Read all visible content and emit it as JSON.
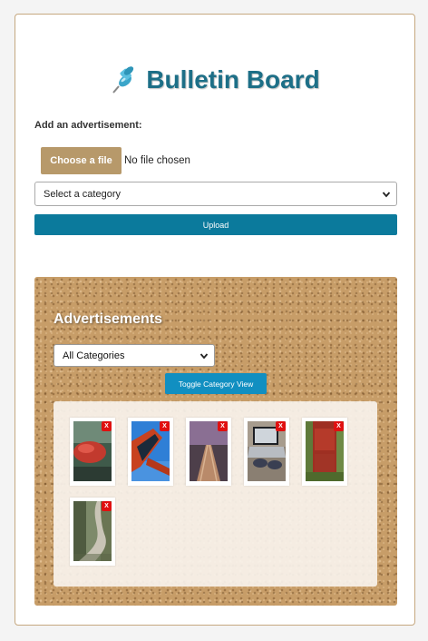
{
  "header": {
    "title": "Bulletin Board",
    "icon": "pushpin-icon"
  },
  "upload_form": {
    "add_label": "Add an advertisement:",
    "choose_file_label": "Choose a file",
    "file_status": "No file chosen",
    "category_selected": "Select a category",
    "upload_label": "Upload"
  },
  "board": {
    "title": "Advertisements",
    "filter_selected": "All Categories",
    "toggle_label": "Toggle Category View",
    "delete_label": "X",
    "ads": [
      {
        "image": "red umbrella in rain"
      },
      {
        "image": "red bridge against blue sky"
      },
      {
        "image": "railway tracks at dusk"
      },
      {
        "image": "hands typing on laptop"
      },
      {
        "image": "red wooden barn door"
      },
      {
        "image": "winding dirt road in forest"
      }
    ]
  },
  "colors": {
    "title": "#1d6f87",
    "choose_button": "#b7996a",
    "upload_button": "#0b7a9c",
    "toggle_button": "#118fc1",
    "delete_badge": "#e01010"
  }
}
